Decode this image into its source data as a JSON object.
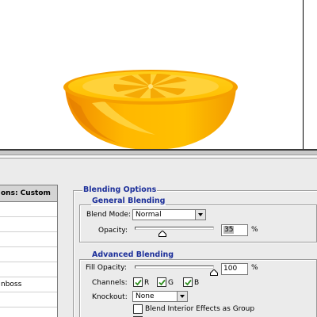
{
  "dialog": {
    "panel_title": "Blending Options",
    "styles_list": {
      "header": "ons: Custom",
      "items": [
        "",
        "",
        "",
        "",
        "",
        "nboss",
        ""
      ]
    },
    "general": {
      "title": "General Blending",
      "blend_mode_label": "Blend Mode:",
      "blend_mode_value": "Normal",
      "opacity_label": "Opacity:",
      "opacity_value": "35",
      "opacity_unit": "%",
      "opacity_percent": 35
    },
    "advanced": {
      "title": "Advanced Blending",
      "fill_opacity_label": "Fill Opacity:",
      "fill_opacity_value": "100",
      "fill_opacity_unit": "%",
      "fill_opacity_percent": 100,
      "channels_label": "Channels:",
      "channel_r": "R",
      "channel_g": "G",
      "channel_b": "B",
      "knockout_label": "Knockout:",
      "knockout_value": "None",
      "blend_interior_label": "Blend Interior Effects as Group"
    }
  },
  "colors": {
    "title_blue": "#1c2f9a",
    "checkmark_green": "#2f8f1f",
    "panel_bg": "#ebebeb",
    "orange": "#f7a800"
  }
}
